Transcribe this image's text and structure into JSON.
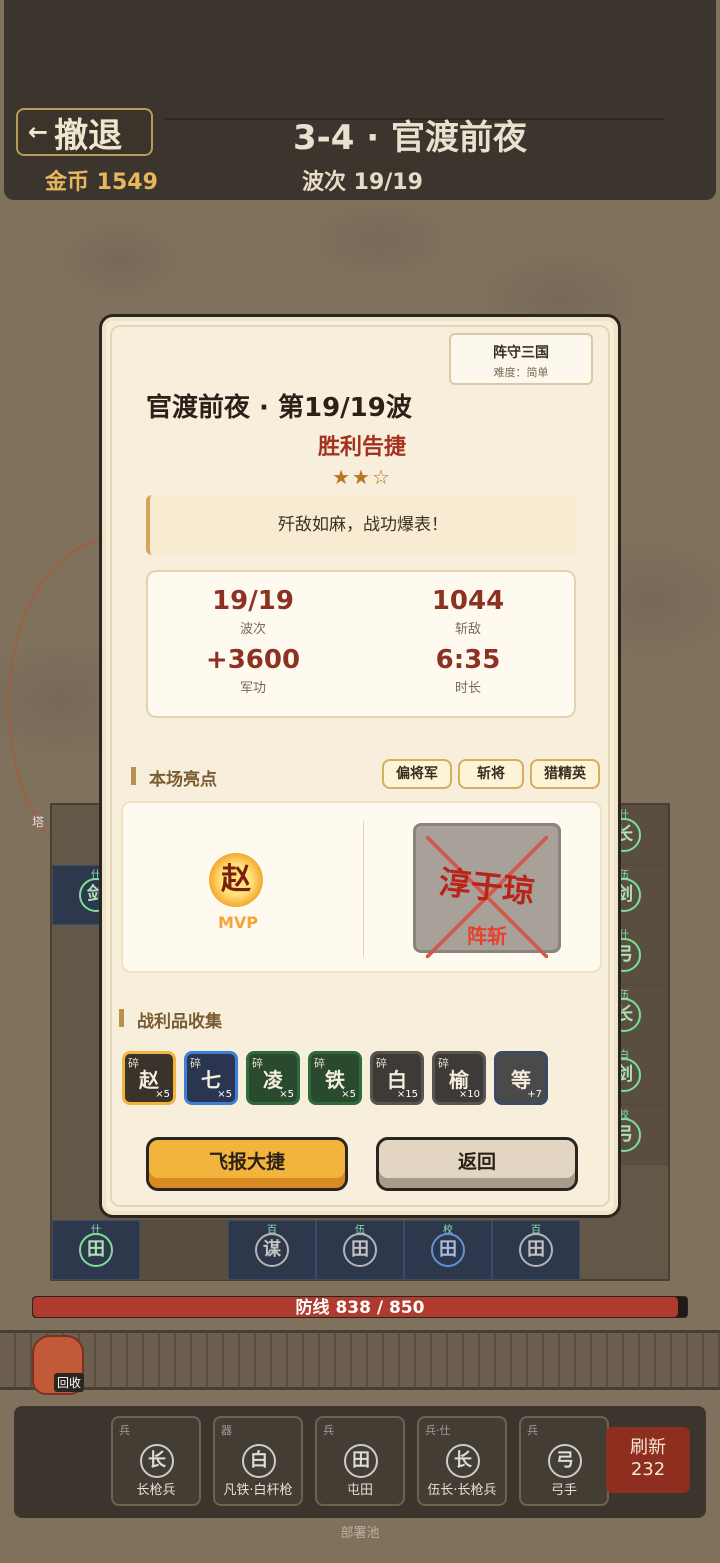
{
  "topbar": {
    "retreat_label": "撤退",
    "level_title": "3-4 · 官渡前夜",
    "gold": "金币 1549",
    "wave": "波次 19/19"
  },
  "board": {
    "tower_label": "塔",
    "left_cell": {
      "tag": "什",
      "glyph": "剑"
    },
    "bottom_row": [
      {
        "tag": "什",
        "glyph": "田"
      },
      {
        "tag": "",
        "glyph": ""
      },
      {
        "tag": "百",
        "glyph": "谋"
      },
      {
        "tag": "伍",
        "glyph": "田"
      },
      {
        "tag": "校",
        "glyph": "田"
      },
      {
        "tag": "百",
        "glyph": "田"
      }
    ],
    "right_column": [
      {
        "tag": "什",
        "glyph": "长"
      },
      {
        "tag": "伍",
        "glyph": "剑"
      },
      {
        "tag": "什",
        "glyph": "弓"
      },
      {
        "tag": "伍",
        "glyph": "长"
      },
      {
        "tag": "白",
        "glyph": "剑"
      },
      {
        "tag": "校",
        "glyph": "弓"
      }
    ]
  },
  "defense": {
    "label": "防线 838 / 850",
    "fraction": 0.986
  },
  "recycle_label": "回收",
  "pool": {
    "label": "部署池",
    "cards": [
      {
        "kind": "兵",
        "icon": "长",
        "name": "长枪兵"
      },
      {
        "kind": "器",
        "icon": "白",
        "name": "凡铁·白杆枪"
      },
      {
        "kind": "兵",
        "icon": "田",
        "name": "屯田"
      },
      {
        "kind": "兵·仕",
        "icon": "长",
        "name": "伍长·长枪兵"
      },
      {
        "kind": "兵",
        "icon": "弓",
        "name": "弓手"
      }
    ],
    "refresh_label": "刷新",
    "refresh_cost": "232"
  },
  "modal": {
    "badge_title": "阵守三国",
    "badge_sub": "难度：简单",
    "title": "官渡前夜 · 第19/19波",
    "result": "胜利告捷",
    "stars": "★★☆",
    "quote": "歼敌如麻，战功爆表！",
    "stats": [
      {
        "value": "19/19",
        "label": "波次"
      },
      {
        "value": "1044",
        "label": "斩敌"
      },
      {
        "value": "+3600",
        "label": "军功"
      },
      {
        "value": "6:35",
        "label": "时长"
      }
    ],
    "highlights_title": "本场亮点",
    "chips": [
      "偏将军",
      "斩将",
      "猎精英"
    ],
    "mvp_hero": "赵",
    "mvp_label": "MVP",
    "killed_general": "淳于琼",
    "kill_tag": "阵斩",
    "loot_title": "战利品收集",
    "loot": [
      {
        "frag": "碎",
        "char": "赵",
        "count": "×5",
        "border": "#f2b43c",
        "bg": "#3a332b"
      },
      {
        "frag": "碎",
        "char": "七",
        "count": "×5",
        "border": "#3d7fd8",
        "bg": "#2a3650"
      },
      {
        "frag": "碎",
        "char": "凌",
        "count": "×5",
        "border": "#2f6a3a",
        "bg": "#2a4a30"
      },
      {
        "frag": "碎",
        "char": "铁",
        "count": "×5",
        "border": "#2f6a3a",
        "bg": "#2a4a30"
      },
      {
        "frag": "碎",
        "char": "白",
        "count": "×15",
        "border": "#5a5450",
        "bg": "#3d3a38"
      },
      {
        "frag": "碎",
        "char": "榆",
        "count": "×10",
        "border": "#5a5450",
        "bg": "#3d3a38"
      },
      {
        "frag": "",
        "char": "等",
        "count": "+7",
        "border": "#3d4a66",
        "bg": "#4a4a4a"
      }
    ],
    "report_label": "飞报大捷",
    "back_label": "返回"
  }
}
